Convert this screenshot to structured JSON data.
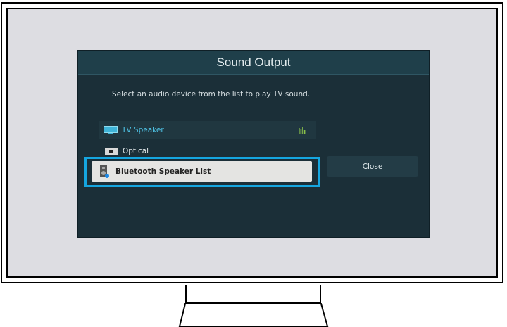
{
  "dialog": {
    "title": "Sound Output",
    "subtitle": "Select an audio device from the list to play TV sound.",
    "devices": [
      {
        "label": "TV Speaker",
        "icon": "tv-icon",
        "status_icon": "audio-level-icon",
        "active": true
      },
      {
        "label": "Optical",
        "icon": "optical-icon"
      },
      {
        "label": "Bluetooth Speaker List",
        "icon": "bluetooth-speaker-icon",
        "focused": true
      }
    ],
    "close_label": "Close"
  },
  "colors": {
    "focus_outline": "#15a6e0",
    "active_text": "#4fc5e8",
    "level_indicator": "#8bc34a",
    "dialog_bg": "#1b2f38"
  }
}
